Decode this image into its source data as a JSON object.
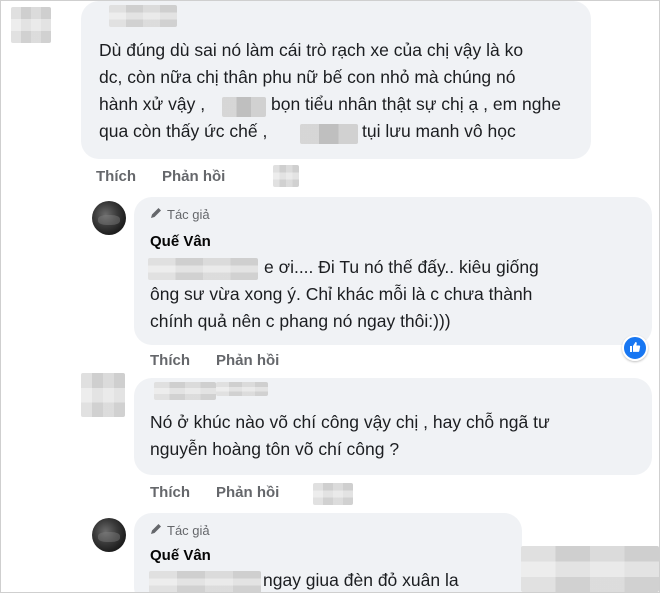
{
  "comments": [
    {
      "lines": [
        "Dù đúng dù sai nó làm cái trò rạch xe của chị vậy là ko",
        "dc, còn nữa chị thân phu nữ bế con nhỏ mà chúng nó",
        "hành xử vậy ,",
        "bọn tiểu nhân thật sự chị ạ , em nghe",
        "qua còn thấy ức chế ,",
        "tụi lưu manh vô học"
      ],
      "like_label": "Thích",
      "reply_label": "Phản hồi"
    },
    {
      "author_tag": "Tác giả",
      "author_name": "Quế Vân",
      "lines": [
        "e ơi.... Đi Tu nó thế đấy.. kiêu giống",
        "ông sư vừa xong ý. Chỉ khác mỗi là c chưa thành",
        "chính quả nên c phang nó ngay thôi:)))"
      ],
      "like_label": "Thích",
      "reply_label": "Phản hồi",
      "reaction_icon": "like-icon"
    },
    {
      "lines": [
        "Nó ở khúc nào võ chí công vậy chị , hay chỗ ngã tư",
        "nguyễn hoàng tôn võ chí công ?"
      ],
      "like_label": "Thích",
      "reply_label": "Phản hồi"
    },
    {
      "author_tag": "Tác giả",
      "author_name": "Quế Vân",
      "lines": [
        "ngay giua đèn đỏ xuân la"
      ]
    }
  ],
  "icons": {
    "author_tag_icon": "pencil-icon",
    "reaction": "thumbs-up-icon"
  },
  "colors": {
    "bubble_bg": "#f0f2f5",
    "action_text": "#65676b",
    "reaction_blue": "#1877f2"
  }
}
